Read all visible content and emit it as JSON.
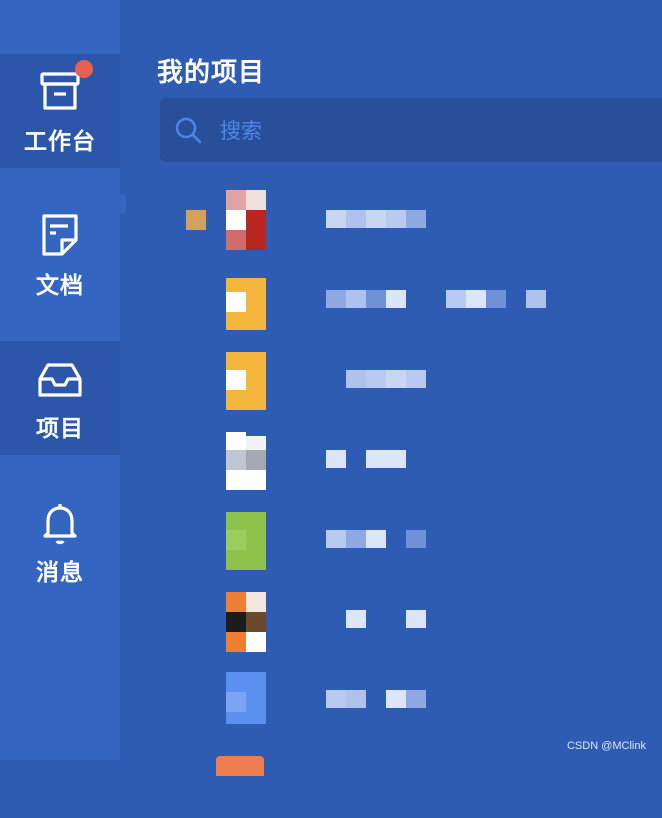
{
  "sidebar": {
    "items": [
      {
        "label": "工作台",
        "icon": "archive-box-icon",
        "badge": true
      },
      {
        "label": "文档",
        "icon": "document-icon"
      },
      {
        "label": "项目",
        "icon": "inbox-tray-icon",
        "active": true
      },
      {
        "label": "消息",
        "icon": "bell-icon"
      }
    ]
  },
  "main": {
    "title": "我的项目",
    "search": {
      "placeholder": "搜索",
      "value": ""
    }
  },
  "watermark": "CSDN @MClink",
  "colors": {
    "background": "#2f5cb3",
    "sidebar": "#3465c0",
    "active_nav": "#2c56aa",
    "badge": "#e5604f",
    "search_box": "#2a4f9a",
    "search_placeholder": "#4f86ea"
  }
}
